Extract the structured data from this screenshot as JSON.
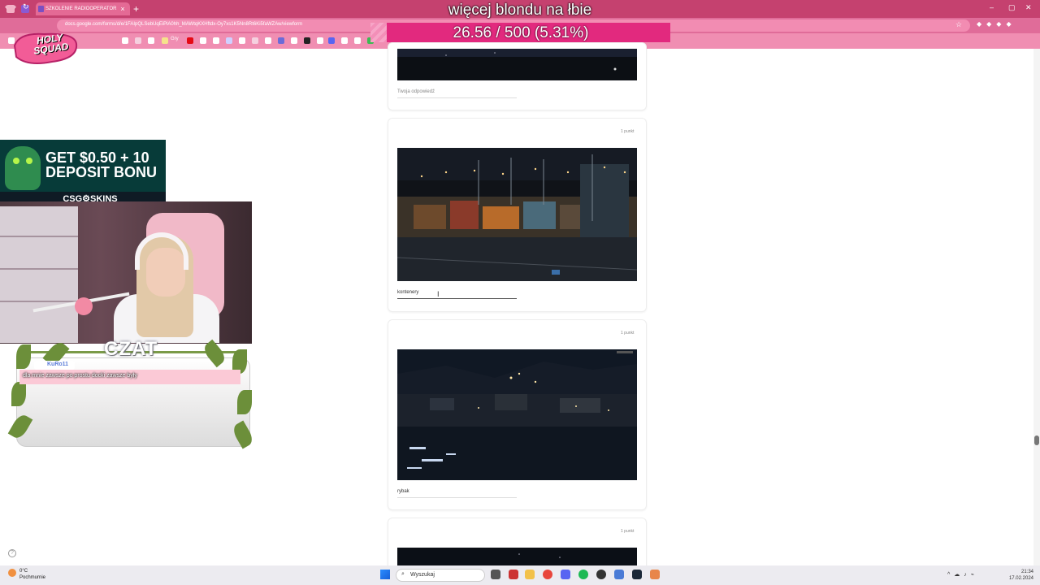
{
  "browser": {
    "tab_title": "SZKOLENIE RADIOOPERATOR",
    "url": "docs.google.com/forms/d/e/1FAIpQLSebUqEiPlA0hh_MAWtqKXHftdx-Oy7xs1K5Nn8Rt6Ki5faWZAw/viewform",
    "bookmark_folder": "Gry"
  },
  "overlay": {
    "goal_title": "więcej blondu na łbie",
    "goal_progress_text": "26.56 / 500 (5.31%)",
    "goal_progress_fraction": 0.0531,
    "logo_text": "HOLY SQUAD",
    "ad_line1": "GET $0.50 + 10",
    "ad_line2": "DEPOSIT BONU",
    "ad_brand": "CSG⚙SKINS",
    "czat_label": "CZAT",
    "chat_user": "KuRo11",
    "chat_message": "dla mnie zawsze po prostu docki zawsze były"
  },
  "form": {
    "cards": [
      {
        "answer": "Twoja odpowiedź",
        "is_placeholder": true
      },
      {
        "points": "1 punkt",
        "answer": "kontenery"
      },
      {
        "points": "1 punkt",
        "answer": "rybak"
      },
      {
        "points": "1 punkt"
      }
    ]
  },
  "taskbar": {
    "weather_temp": "0°C",
    "weather_desc": "Pochmurnie",
    "search_placeholder": "Wyszukaj",
    "time": "21:34",
    "date": "17.02.2024"
  },
  "colors": {
    "chrome": "#c5416f",
    "goal_bar": "#e2297e",
    "accent_pink": "#f08eb2"
  }
}
